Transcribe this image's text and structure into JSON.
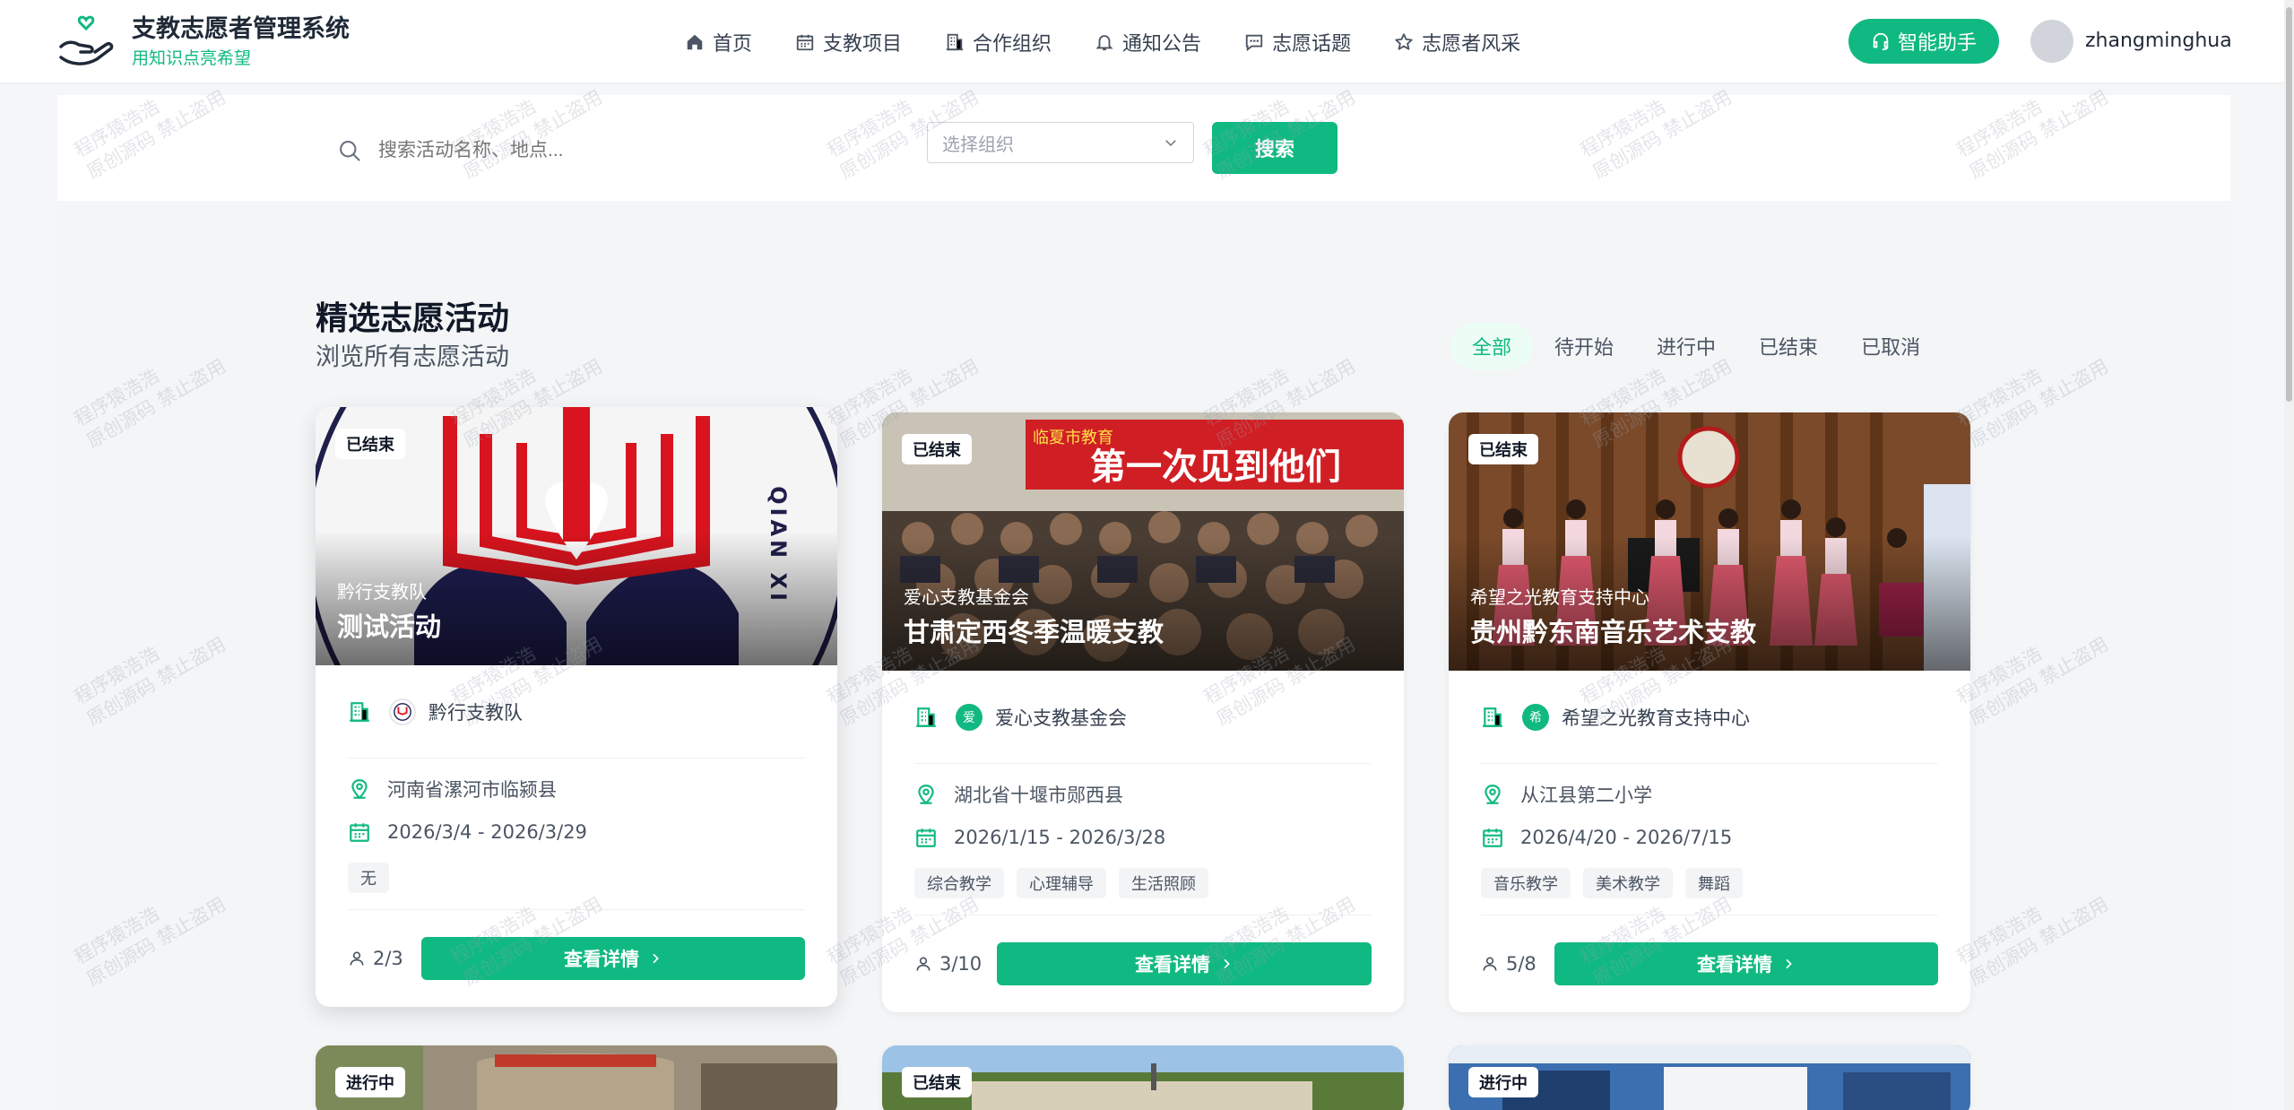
{
  "header": {
    "brand_title": "支教志愿者管理系统",
    "brand_subtitle": "用知识点亮希望",
    "nav": [
      {
        "label": "首页",
        "icon": "home-icon"
      },
      {
        "label": "支教项目",
        "icon": "calendar-icon"
      },
      {
        "label": "合作组织",
        "icon": "building-icon"
      },
      {
        "label": "通知公告",
        "icon": "bell-icon"
      },
      {
        "label": "志愿话题",
        "icon": "chat-icon"
      },
      {
        "label": "志愿者风采",
        "icon": "star-icon"
      }
    ],
    "assistant_label": "智能助手",
    "username": "zhangminghua"
  },
  "search": {
    "placeholder": "搜索活动名称、地点...",
    "org_placeholder": "选择组织",
    "button_label": "搜索"
  },
  "section": {
    "title": "精选志愿活动",
    "subtitle": "浏览所有志愿活动",
    "filters": [
      "全部",
      "待开始",
      "进行中",
      "已结束",
      "已取消"
    ],
    "active_filter": "全部"
  },
  "cards": [
    {
      "status": "已结束",
      "org_overlay": "黔行支教队",
      "title": "测试活动",
      "org": "黔行支教队",
      "location": "河南省漯河市临颍县",
      "dates": "2026/3/4 - 2026/3/29",
      "tags": [
        "无"
      ],
      "count": "2/3",
      "button": "查看详情"
    },
    {
      "status": "已结束",
      "org_overlay": "爱心支教基金会",
      "title": "甘肃定西冬季温暖支教",
      "org": "爱心支教基金会",
      "org_logo_char": "爱",
      "location": "湖北省十堰市郧西县",
      "dates": "2026/1/15 - 2026/3/28",
      "tags": [
        "综合教学",
        "心理辅导",
        "生活照顾"
      ],
      "count": "3/10",
      "button": "查看详情",
      "banner_text": "第一次见到他们",
      "banner_small": "临夏市教育"
    },
    {
      "status": "已结束",
      "org_overlay": "希望之光教育支持中心",
      "title": "贵州黔东南音乐艺术支教",
      "org": "希望之光教育支持中心",
      "org_logo_char": "希",
      "location": "从江县第二小学",
      "dates": "2026/4/20 - 2026/7/15",
      "tags": [
        "音乐教学",
        "美术教学",
        "舞蹈"
      ],
      "count": "5/8",
      "button": "查看详情"
    }
  ],
  "next_row_status": [
    "进行中",
    "已结束",
    "进行中"
  ],
  "logo_text": "QIAN XI",
  "watermark": [
    "程序猿浩浩",
    "原创源码 禁止盗用"
  ],
  "colors": {
    "accent": "#10b981",
    "text": "#1f2937"
  }
}
